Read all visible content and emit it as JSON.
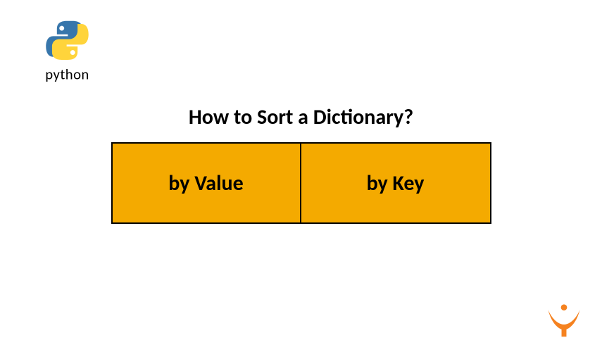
{
  "logo": {
    "name": "python",
    "text": "python"
  },
  "title": "How to Sort a Dictionary?",
  "options": [
    {
      "label": "by Value"
    },
    {
      "label": "by Key"
    }
  ],
  "colors": {
    "box_bg": "#f4aa00",
    "box_border": "#000000",
    "python_blue": "#3776ab",
    "python_yellow": "#ffd43b",
    "bottom_logo": "#f58220"
  }
}
